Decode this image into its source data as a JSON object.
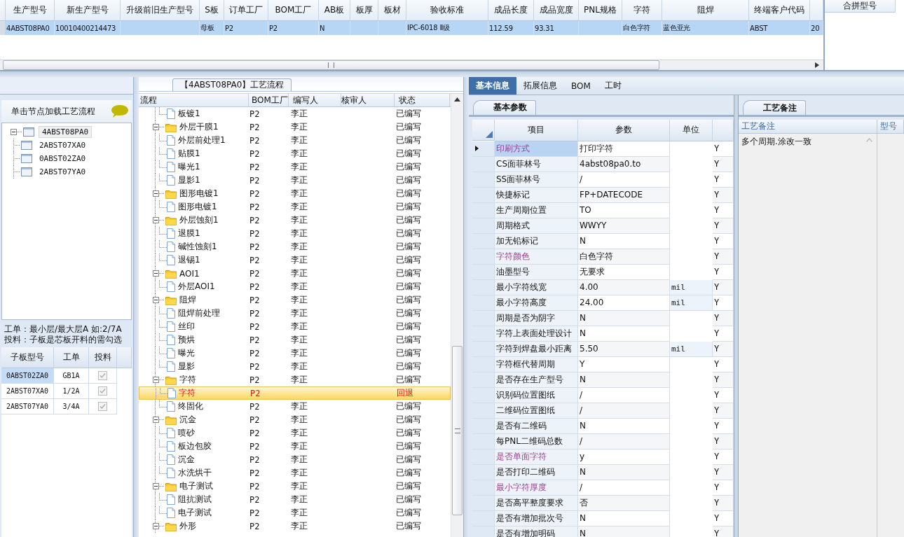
{
  "product_table": {
    "columns": [
      "生产型号",
      "新生产型号",
      "升级前旧生产型号",
      "S板",
      "订单工厂",
      "BOM工厂",
      "AB板",
      "板厚",
      "板材",
      "验收标准",
      "成品长度",
      "成品宽度",
      "PNL规格",
      "字符",
      "阻焊",
      "终端客户代码"
    ],
    "rows": [
      {
        "selected": true,
        "cells": [
          "4ABST08PA0",
          "10010400214473",
          null,
          "母板",
          "P2",
          "P2",
          "N",
          null,
          null,
          "IPC-6018 Ⅱ级",
          "112.59",
          "93.31",
          null,
          "白色字符",
          "蓝色亚光",
          "ABST",
          "20"
        ]
      }
    ]
  },
  "merge_panel": {
    "title": "合拼型号"
  },
  "sub_boards": {
    "hint": "单击节点加载工艺流程",
    "tree": [
      {
        "label": "4ABST08PA0",
        "selected": true,
        "expanded": true,
        "children": [
          {
            "label": "2ABST07XA0",
            "selected": false
          },
          {
            "label": "0ABST02ZA0",
            "selected": false
          },
          {
            "label": "2ABST07YA0",
            "selected": false
          }
        ]
      }
    ],
    "notes": [
      "工单：最小层/最大层A 如:2/7A",
      "投料：子板是芯板开料的需勾选"
    ],
    "grid": {
      "columns": [
        "子板型号",
        "工单",
        "投料"
      ],
      "rows": [
        {
          "model": "0ABST02ZA0",
          "order": "GB1A",
          "feed": true,
          "selected": true
        },
        {
          "model": "2ABST07XA0",
          "order": "1/2A",
          "feed": true,
          "selected": false
        },
        {
          "model": "2ABST07YA0",
          "order": "3/4A",
          "feed": true,
          "selected": false
        }
      ]
    }
  },
  "flow": {
    "title": "【4ABST08PA0】工艺流程",
    "columns": [
      "流程",
      "BOM工厂",
      "编写人",
      "核审人",
      "状态"
    ],
    "rows": [
      {
        "kind": "step",
        "name": "板镀1",
        "factory": "P2",
        "writer": "李正",
        "status": "已编写",
        "selected": false
      },
      {
        "kind": "group",
        "name": "外层干膜1",
        "factory": "P2",
        "writer": "李正",
        "status": "已编写",
        "selected": false,
        "expanded": true,
        "children": [
          {
            "kind": "step",
            "name": "外层前处理1",
            "factory": "P2",
            "writer": "李正",
            "status": "已编写",
            "selected": false
          },
          {
            "kind": "step",
            "name": "贴膜1",
            "factory": "P2",
            "writer": "李正",
            "status": "已编写",
            "selected": false
          },
          {
            "kind": "step",
            "name": "曝光1",
            "factory": "P2",
            "writer": "李正",
            "status": "已编写",
            "selected": false
          },
          {
            "kind": "step",
            "name": "显影1",
            "factory": "P2",
            "writer": "李正",
            "status": "已编写",
            "selected": false
          }
        ]
      },
      {
        "kind": "group",
        "name": "图形电镀1",
        "factory": "P2",
        "writer": "李正",
        "status": "已编写",
        "selected": false,
        "expanded": true,
        "children": [
          {
            "kind": "step",
            "name": "图形电镀1",
            "factory": "P2",
            "writer": "李正",
            "status": "已编写",
            "selected": false
          }
        ]
      },
      {
        "kind": "group",
        "name": "外层蚀刻1",
        "factory": "P2",
        "writer": "李正",
        "status": "已编写",
        "selected": false,
        "expanded": true,
        "children": [
          {
            "kind": "step",
            "name": "退膜1",
            "factory": "P2",
            "writer": "李正",
            "status": "已编写",
            "selected": false
          },
          {
            "kind": "step",
            "name": "碱性蚀刻1",
            "factory": "P2",
            "writer": "李正",
            "status": "已编写",
            "selected": false
          },
          {
            "kind": "step",
            "name": "退锡1",
            "factory": "P2",
            "writer": "李正",
            "status": "已编写",
            "selected": false
          }
        ]
      },
      {
        "kind": "group",
        "name": "AOI1",
        "factory": "P2",
        "writer": "李正",
        "status": "已编写",
        "selected": false,
        "expanded": true,
        "children": [
          {
            "kind": "step",
            "name": "外层AOI1",
            "factory": "P2",
            "writer": "李正",
            "status": "已编写",
            "selected": false
          }
        ]
      },
      {
        "kind": "group",
        "name": "阻焊",
        "factory": "P2",
        "writer": "李正",
        "status": "已编写",
        "selected": false,
        "expanded": true,
        "children": [
          {
            "kind": "step",
            "name": "阻焊前处理",
            "factory": "P2",
            "writer": "李正",
            "status": "已编写",
            "selected": false
          },
          {
            "kind": "step",
            "name": "丝印",
            "factory": "P2",
            "writer": "李正",
            "status": "已编写",
            "selected": false
          },
          {
            "kind": "step",
            "name": "预烘",
            "factory": "P2",
            "writer": "李正",
            "status": "已编写",
            "selected": false
          },
          {
            "kind": "step",
            "name": "曝光",
            "factory": "P2",
            "writer": "李正",
            "status": "已编写",
            "selected": false
          },
          {
            "kind": "step",
            "name": "显影",
            "factory": "P2",
            "writer": "李正",
            "status": "已编写",
            "selected": false
          }
        ]
      },
      {
        "kind": "group",
        "name": "字符",
        "factory": "P2",
        "writer": "李正",
        "status": "已编写",
        "selected": false,
        "expanded": true,
        "children": [
          {
            "kind": "step",
            "name": "字符",
            "factory": "P2",
            "status": "回退",
            "selected": true
          },
          {
            "kind": "step",
            "name": "终固化",
            "factory": "P2",
            "writer": "李正",
            "status": "已编写",
            "selected": false
          }
        ]
      },
      {
        "kind": "group",
        "name": "沉金",
        "factory": "P2",
        "writer": "李正",
        "status": "已编写",
        "selected": false,
        "expanded": true,
        "children": [
          {
            "kind": "step",
            "name": "喷砂",
            "factory": "P2",
            "writer": "李正",
            "status": "已编写",
            "selected": false
          },
          {
            "kind": "step",
            "name": "板边包胶",
            "factory": "P2",
            "writer": "李正",
            "status": "已编写",
            "selected": false
          },
          {
            "kind": "step",
            "name": "沉金",
            "factory": "P2",
            "writer": "李正",
            "status": "已编写",
            "selected": false
          },
          {
            "kind": "step",
            "name": "水洗烘干",
            "factory": "P2",
            "writer": "李正",
            "status": "已编写",
            "selected": false
          }
        ]
      },
      {
        "kind": "group",
        "name": "电子测试",
        "factory": "P2",
        "writer": "李正",
        "status": "已编写",
        "selected": false,
        "expanded": true,
        "children": [
          {
            "kind": "step",
            "name": "阻抗测试",
            "factory": "P2",
            "writer": "李正",
            "status": "已编写",
            "selected": false
          },
          {
            "kind": "step",
            "name": "电子测试",
            "factory": "P2",
            "writer": "李正",
            "status": "已编写",
            "selected": false
          }
        ]
      },
      {
        "kind": "group",
        "name": "外形",
        "factory": "P2",
        "writer": "李正",
        "status": "已编写",
        "selected": false,
        "expanded": true
      }
    ]
  },
  "details": {
    "tabs": [
      {
        "label": "基本信息",
        "selected": true
      },
      {
        "label": "拓展信息",
        "selected": false
      },
      {
        "label": "BOM",
        "selected": false
      },
      {
        "label": "工时",
        "selected": false
      }
    ],
    "params_tab": "基本参数",
    "params": {
      "columns": [
        "项目",
        "参数",
        "单位"
      ],
      "rows": [
        {
          "item": "印刷方式",
          "value": "打印字符",
          "flag": "Y",
          "highlighted": true,
          "selected": true
        },
        {
          "item": "CS面菲林号",
          "value": "4abst08pa0.to",
          "flag": "Y",
          "highlighted": false,
          "selected": false
        },
        {
          "item": "SS面菲林号",
          "value": "/",
          "flag": "Y",
          "highlighted": false,
          "selected": false
        },
        {
          "item": "快捷标记",
          "value": "FP+DATECODE",
          "flag": "Y",
          "highlighted": false,
          "selected": false
        },
        {
          "item": "生产周期位置",
          "value": "TO",
          "flag": "Y",
          "highlighted": false,
          "selected": false
        },
        {
          "item": "周期格式",
          "value": "WWYY",
          "flag": "Y",
          "highlighted": false,
          "selected": false
        },
        {
          "item": "加无铅标记",
          "value": "N",
          "flag": "Y",
          "highlighted": false,
          "selected": false
        },
        {
          "item": "字符颜色",
          "value": "白色字符",
          "flag": "Y",
          "highlighted": true,
          "selected": false
        },
        {
          "item": "油墨型号",
          "value": "无要求",
          "flag": "Y",
          "highlighted": false,
          "selected": false
        },
        {
          "item": "最小字符线宽",
          "value": "4.00",
          "unit": "mil",
          "flag": "Y",
          "highlighted": false,
          "selected": false
        },
        {
          "item": "最小字符高度",
          "value": "24.00",
          "unit": "mil",
          "flag": "Y",
          "highlighted": false,
          "selected": false
        },
        {
          "item": "周期是否为阴字",
          "value": "N",
          "flag": "Y",
          "highlighted": false,
          "selected": false
        },
        {
          "item": "字符上表面处理设计",
          "value": "N",
          "flag": "Y",
          "highlighted": false,
          "selected": false
        },
        {
          "item": "字符到焊盘最小距离",
          "value": "5.50",
          "unit": "mil",
          "flag": "Y",
          "highlighted": false,
          "selected": false
        },
        {
          "item": "字符框代替周期",
          "value": "Y",
          "flag": "Y",
          "highlighted": false,
          "selected": false
        },
        {
          "item": "是否存在生产型号",
          "value": "N",
          "flag": "Y",
          "highlighted": false,
          "selected": false
        },
        {
          "item": "识别码位置图纸",
          "value": "/",
          "flag": "Y",
          "highlighted": false,
          "selected": false
        },
        {
          "item": "二维码位置图纸",
          "value": "/",
          "flag": "Y",
          "highlighted": false,
          "selected": false
        },
        {
          "item": "是否有二维码",
          "value": "N",
          "flag": "Y",
          "highlighted": false,
          "selected": false
        },
        {
          "item": "每PNL二维码总数",
          "value": "/",
          "flag": "Y",
          "highlighted": false,
          "selected": false
        },
        {
          "item": "是否单面字符",
          "value": "y",
          "flag": "Y",
          "highlighted": true,
          "selected": false
        },
        {
          "item": "是否打印二维码",
          "value": "N",
          "flag": "Y",
          "highlighted": false,
          "selected": false
        },
        {
          "item": "最小字符厚度",
          "value": "/",
          "flag": "Y",
          "highlighted": true,
          "selected": false
        },
        {
          "item": "是否高平整度要求",
          "value": "否",
          "flag": "Y",
          "highlighted": false,
          "selected": false
        },
        {
          "item": "是否有增加批次号",
          "value": "N",
          "flag": "Y",
          "highlighted": false,
          "selected": false
        },
        {
          "item": "是否有增加明码",
          "value": "N",
          "flag": "Y",
          "highlighted": false,
          "selected": false
        }
      ]
    },
    "remarks_tab": "工艺备注",
    "remarks": {
      "columns": [
        "工艺备注",
        "型号"
      ],
      "text": "多个周期.涂改一致"
    }
  }
}
